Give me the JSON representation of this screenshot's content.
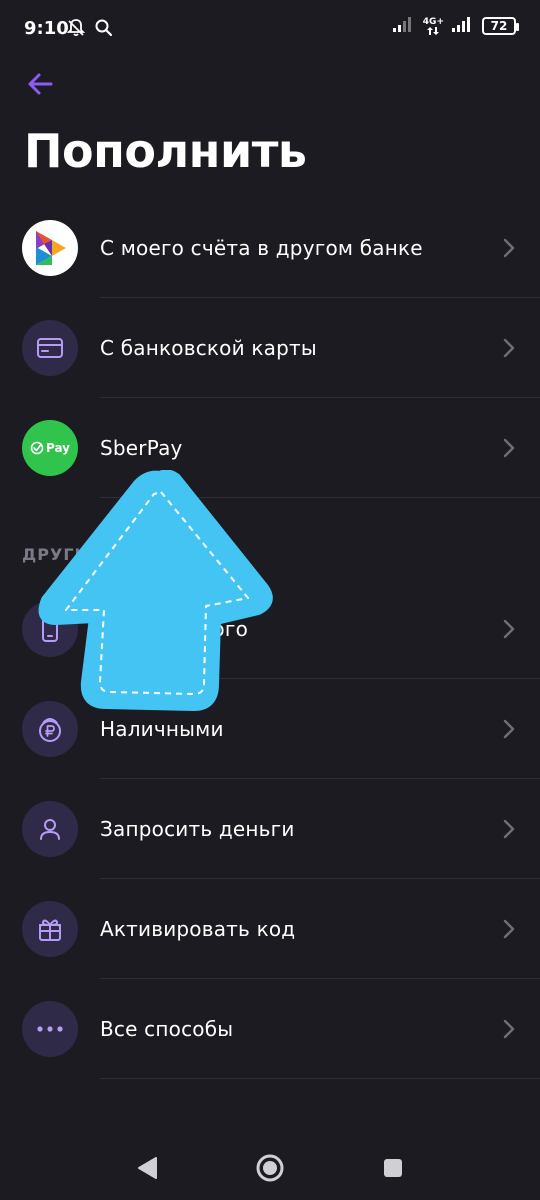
{
  "status_bar": {
    "time": "9:10",
    "network": "4G+",
    "battery": "72"
  },
  "header": {
    "title": "Пополнить"
  },
  "main_items": [
    {
      "label": "С моего счёта в другом банке",
      "icon": "sbp-icon"
    },
    {
      "label": "С банковской карты",
      "icon": "card-icon"
    },
    {
      "label": "SberPay",
      "icon": "sberpay-icon",
      "icon_text": "Pay"
    }
  ],
  "other_section": {
    "title": "ДРУГИЕ",
    "items": [
      {
        "label": "С мобильного",
        "icon": "phone-icon"
      },
      {
        "label": "Наличными",
        "icon": "cash-icon"
      },
      {
        "label": "Запросить деньги",
        "icon": "person-icon"
      },
      {
        "label": "Активировать код",
        "icon": "gift-icon"
      },
      {
        "label": "Все способы",
        "icon": "more-icon"
      }
    ]
  },
  "colors": {
    "background": "#1c1b21",
    "accent": "#8b5cf6",
    "icon_bg": "#2f2a47",
    "sberpay_green": "#30c44c",
    "overlay_arrow": "#44c4f2"
  }
}
